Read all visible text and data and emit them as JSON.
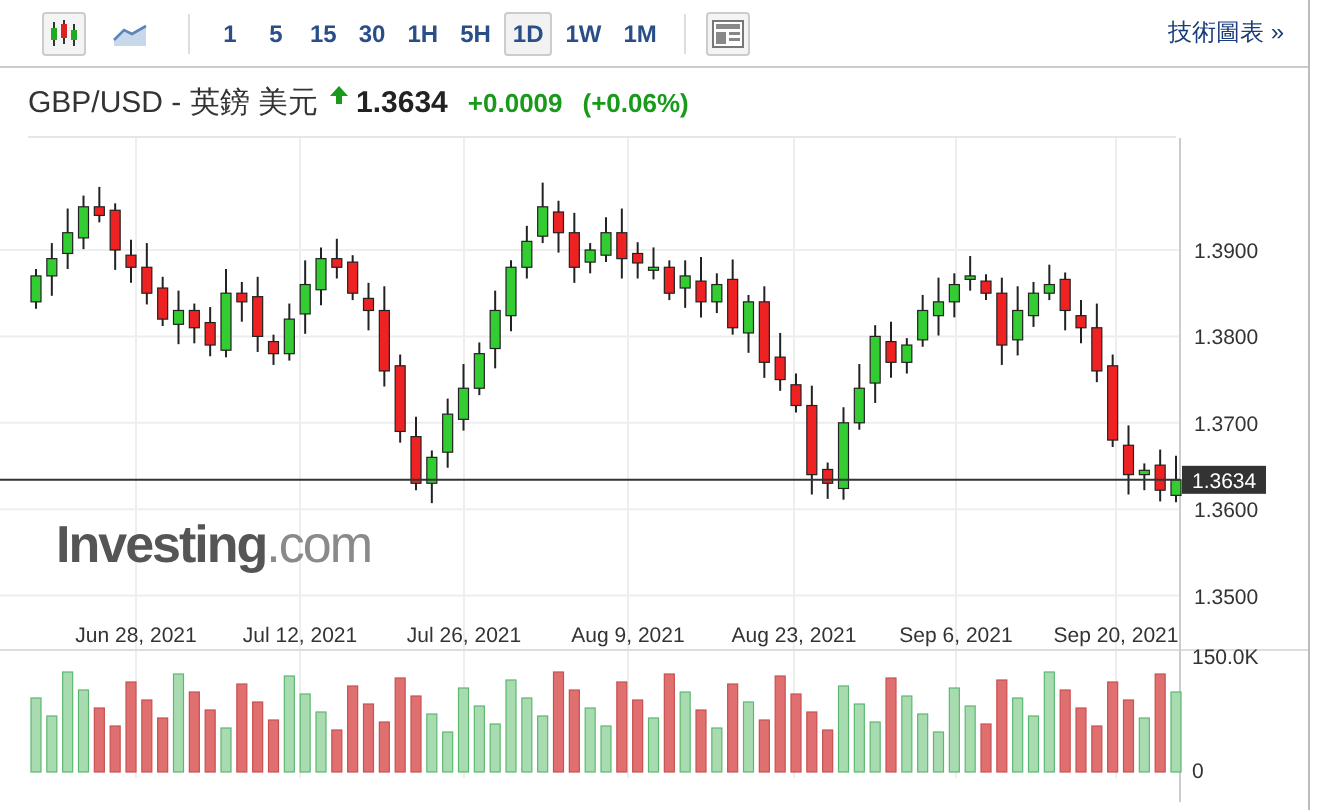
{
  "toolbar": {
    "chart_types": [
      {
        "kind": "candlestick",
        "selected": true
      },
      {
        "kind": "line",
        "selected": false
      }
    ],
    "intervals": [
      {
        "label": "1",
        "selected": false
      },
      {
        "label": "5",
        "selected": false
      },
      {
        "label": "15",
        "selected": false
      },
      {
        "label": "30",
        "selected": false
      },
      {
        "label": "1H",
        "selected": false
      },
      {
        "label": "5H",
        "selected": false
      },
      {
        "label": "1D",
        "selected": true
      },
      {
        "label": "1W",
        "selected": false
      },
      {
        "label": "1M",
        "selected": false
      }
    ],
    "link": "技術圖表 »"
  },
  "header": {
    "pair": "GBP/USD - 英鎊 美元",
    "up": true,
    "price": "1.3634",
    "change": "+0.0009",
    "change_percent": "(+0.06%)"
  },
  "chart": {
    "watermark": "**Investing**.com",
    "price_ticks": [
      "1.3900",
      "1.3800",
      "1.3700",
      "1.3600",
      "1.3500"
    ],
    "current_price": "1.3634",
    "date_ticks": [
      "Jun 28, 2021",
      "Jul 12, 2021",
      "Jul 26, 2021",
      "Aug 9, 2021",
      "Aug 23, 2021",
      "Sep 6, 2021",
      "Sep 20, 2021"
    ],
    "volume_ticks": [
      "150.0K",
      "0"
    ]
  }
}
